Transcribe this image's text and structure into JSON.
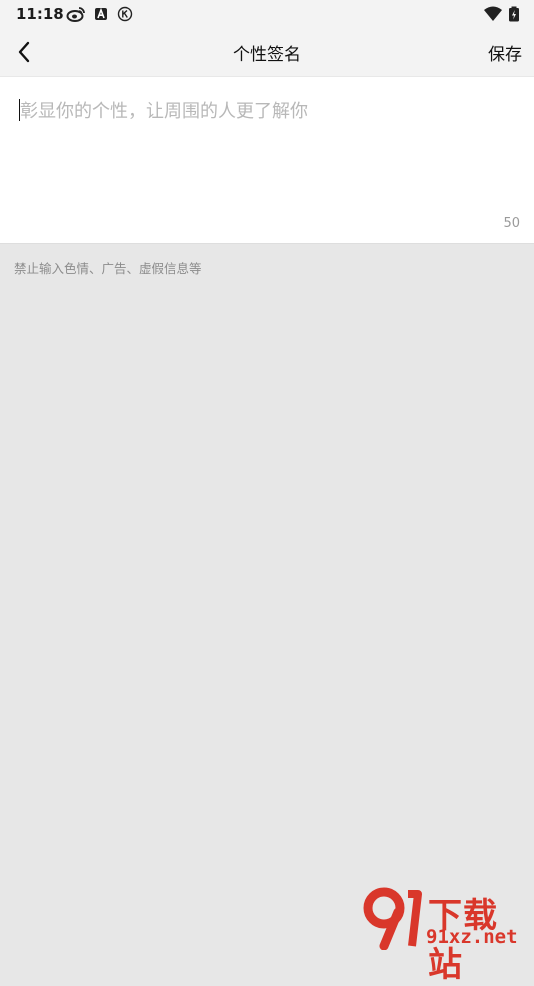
{
  "status_bar": {
    "time": "11:18",
    "icons": [
      "weibo-icon",
      "a-badge-icon",
      "k-circle-icon",
      "wifi-icon",
      "battery-icon"
    ]
  },
  "header": {
    "title": "个性签名",
    "save_label": "保存",
    "back_icon": "chevron-left-icon"
  },
  "editor": {
    "value": "",
    "placeholder": "彰显你的个性，让周围的人更了解你",
    "char_limit": "50"
  },
  "hint": "禁止输入色情、广告、虚假信息等",
  "watermark": {
    "top_text": "下载站",
    "bottom_text": "91xz.net",
    "brand_color": "#d9372b"
  }
}
